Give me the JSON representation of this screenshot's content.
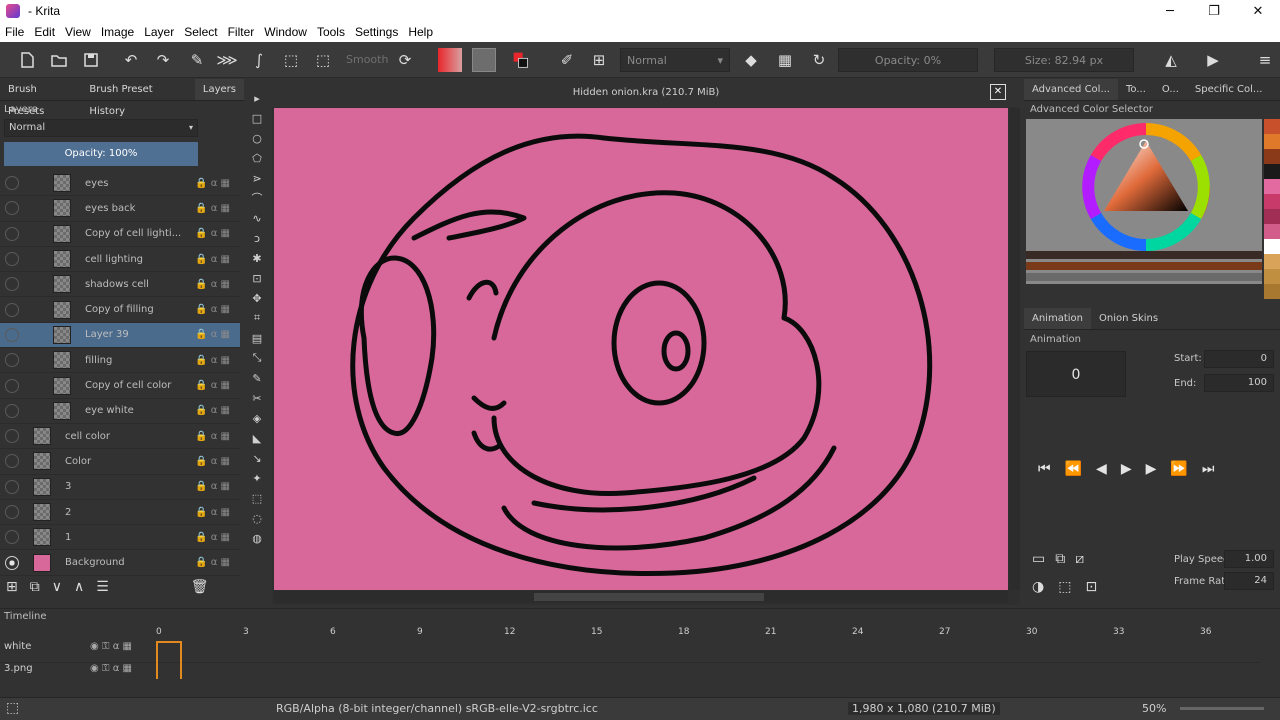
{
  "window": {
    "title": "- Krita"
  },
  "menu": [
    "File",
    "Edit",
    "View",
    "Image",
    "Layer",
    "Select",
    "Filter",
    "Window",
    "Tools",
    "Settings",
    "Help"
  ],
  "toolbar": {
    "smooth_label": "Smooth",
    "blend_mode": "Normal",
    "opacity_label": "Opacity: 0%",
    "size_label": "Size: 82.94 px",
    "fg_color": "#e8262b",
    "bg_color": "#111111"
  },
  "left_panel": {
    "tabs": [
      "Brush Presets",
      "Brush Preset History",
      "Layers"
    ],
    "active_tab": "Layers",
    "title": "Layers",
    "blend_mode": "Normal",
    "opacity": "Opacity: 100%",
    "layers": [
      {
        "name": "eyes",
        "visible": false,
        "selected": false
      },
      {
        "name": "eyes back",
        "visible": false,
        "selected": false
      },
      {
        "name": "Copy of cell lighti...",
        "visible": false,
        "selected": false
      },
      {
        "name": "cell lighting",
        "visible": false,
        "selected": false
      },
      {
        "name": "shadows cell",
        "visible": false,
        "selected": false
      },
      {
        "name": "Copy of filling",
        "visible": false,
        "selected": false
      },
      {
        "name": "Layer 39",
        "visible": false,
        "selected": true
      },
      {
        "name": "filling",
        "visible": false,
        "selected": false
      },
      {
        "name": "Copy of cell color",
        "visible": false,
        "selected": false
      },
      {
        "name": "eye white",
        "visible": false,
        "selected": false
      },
      {
        "name": "cell color",
        "visible": false,
        "selected": false
      },
      {
        "name": "Color",
        "visible": false,
        "selected": false
      },
      {
        "name": "3",
        "visible": false,
        "selected": false
      },
      {
        "name": "2",
        "visible": false,
        "selected": false
      },
      {
        "name": "1",
        "visible": false,
        "selected": false
      },
      {
        "name": "Background",
        "visible": true,
        "selected": false
      }
    ]
  },
  "document": {
    "title": "Hidden onion.kra (210.7 MiB)",
    "canvas_color": "#d8679a"
  },
  "right_panel": {
    "tabs": [
      "Advanced Col...",
      "To...",
      "O...",
      "Specific Col..."
    ],
    "color_selector_title": "Advanced Color Selector",
    "anim_tabs": [
      "Animation",
      "Onion Skins"
    ],
    "anim_title": "Animation",
    "current_frame": "0",
    "start_label": "Start:",
    "start_value": "0",
    "end_label": "End:",
    "end_value": "100",
    "play_speed_label": "Play Speed:",
    "play_speed_value": "1.00",
    "frame_rate_label": "Frame Rate:",
    "frame_rate_value": "24",
    "swatches": [
      "#c8502a",
      "#e07a2a",
      "#8a3a18",
      "#1a1a1a",
      "#e26aa0",
      "#c73a6a",
      "#a02e55",
      "#d25c8a",
      "#ffffff",
      "#d9a35a",
      "#c09040",
      "#a87830"
    ]
  },
  "timeline": {
    "title": "Timeline",
    "ruler": [
      "0",
      "3",
      "6",
      "9",
      "12",
      "15",
      "18",
      "21",
      "24",
      "27",
      "30",
      "33",
      "36"
    ],
    "rows": [
      "white",
      "3.png"
    ]
  },
  "statusbar": {
    "color_info": "RGB/Alpha (8-bit integer/channel)  sRGB-elle-V2-srgbtrc.icc",
    "size_info": "1,980 x 1,080 (210.7 MiB)",
    "zoom": "50%"
  }
}
